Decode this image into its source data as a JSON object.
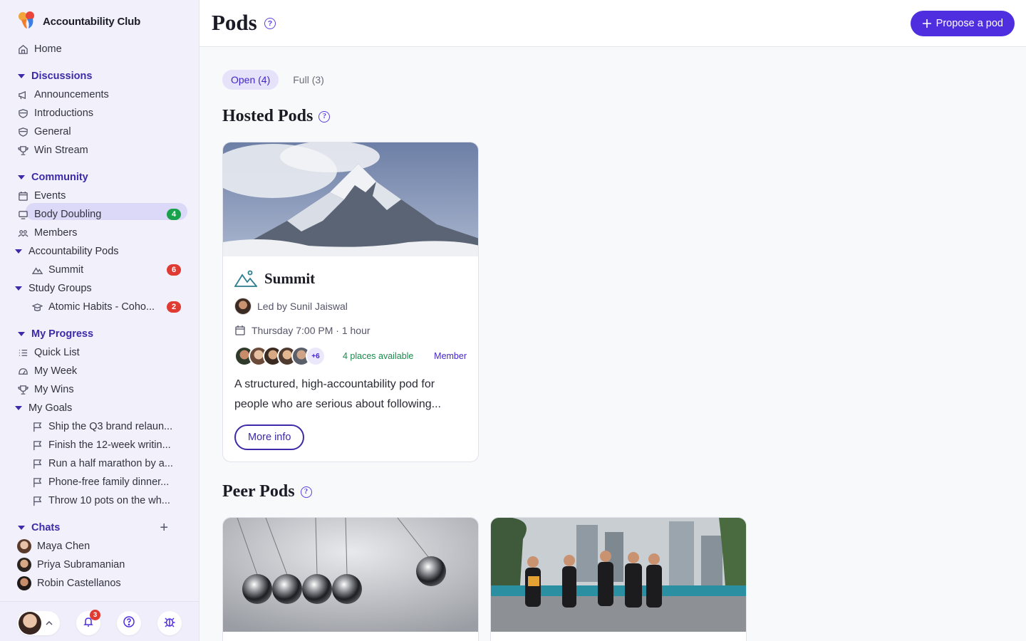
{
  "brand": {
    "name": "Accountability Club"
  },
  "sidebar": {
    "home": "Home",
    "discussions": {
      "label": "Discussions",
      "items": [
        "Announcements",
        "Introductions",
        "General",
        "Win Stream"
      ]
    },
    "community": {
      "label": "Community",
      "events": "Events",
      "body_doubling": "Body Doubling",
      "body_doubling_count": "4",
      "members": "Members",
      "pods": "Accountability Pods",
      "summit": "Summit",
      "summit_count": "6",
      "study_groups": "Study Groups",
      "atomic": "Atomic Habits - Coho...",
      "atomic_count": "2"
    },
    "progress": {
      "label": "My Progress",
      "quick_list": "Quick List",
      "my_week": "My Week",
      "my_wins": "My Wins",
      "my_goals": "My Goals",
      "goals": [
        "Ship the Q3 brand relaun...",
        "Finish the 12-week writin...",
        "Run a half marathon by a...",
        "Phone-free family dinner...",
        "Throw 10 pots on the wh..."
      ]
    },
    "chats": {
      "label": "Chats",
      "people": [
        "Maya Chen",
        "Priya Subramanian",
        "Robin Castellanos"
      ]
    },
    "notifications_count": "3"
  },
  "header": {
    "title": "Pods",
    "propose_label": "Propose a pod"
  },
  "tabs": {
    "open": "Open (4)",
    "full": "Full (3)"
  },
  "hosted": {
    "title": "Hosted Pods",
    "card": {
      "name": "Summit",
      "leader": "Led by Sunil Jaiswal",
      "schedule": "Thursday 7:00 PM · 1 hour",
      "more_members": "+6",
      "places": "4 places available",
      "role": "Member",
      "description_1": "A structured, high-accountability pod for",
      "description_2": "people who are serious about following...",
      "more_info": "More info"
    }
  },
  "peer": {
    "title": "Peer Pods"
  },
  "colors": {
    "accent": "#4f2ee0",
    "section": "#3c2aa8",
    "green_badge": "#19a14b",
    "red_badge": "#e03b32"
  }
}
